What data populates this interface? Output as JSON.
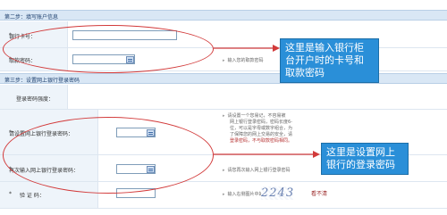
{
  "step2": {
    "title": "第二步：填写账户信息"
  },
  "card_row": {
    "label": "银行卡号：",
    "required": "*"
  },
  "withdraw_row": {
    "label": "取款密码：",
    "required": "*",
    "hint": "输入您的取款密码"
  },
  "step3": {
    "title": "第三步：设置网上银行登录密码"
  },
  "strength_row": {
    "label": "登录密码强度："
  },
  "login_pwd_row": {
    "label": "请设置网上银行登录密码：",
    "required": "*",
    "hint_lines": [
      "请设置一个您易记，不容易被",
      "网上银行登录密码，密码长度6-",
      "位，可以是字母或数字组合，为",
      "了保障您的网上交易的安全，请",
      "登录密码，不与取款密码相同。"
    ]
  },
  "confirm_row": {
    "label": "再次输入网上银行登录密码：",
    "required": "*",
    "hint": "请您再次输入网上银行登录密码"
  },
  "captcha_row": {
    "label": "验 证 码：",
    "required": "*",
    "hint": "输入右侧图片中的字符",
    "captcha_text": "2243",
    "refresh": "看不清"
  },
  "callout_top": [
    "这里是输入银行柜",
    "台开户时的卡号和",
    "取款密码"
  ],
  "callout_bottom": [
    "这里是设置网上",
    "银行的登录密码"
  ],
  "colors": {
    "annotation": "#d23a3a",
    "callout_bg": "#2a8fd8",
    "section_bar": "#d9e7f5"
  }
}
